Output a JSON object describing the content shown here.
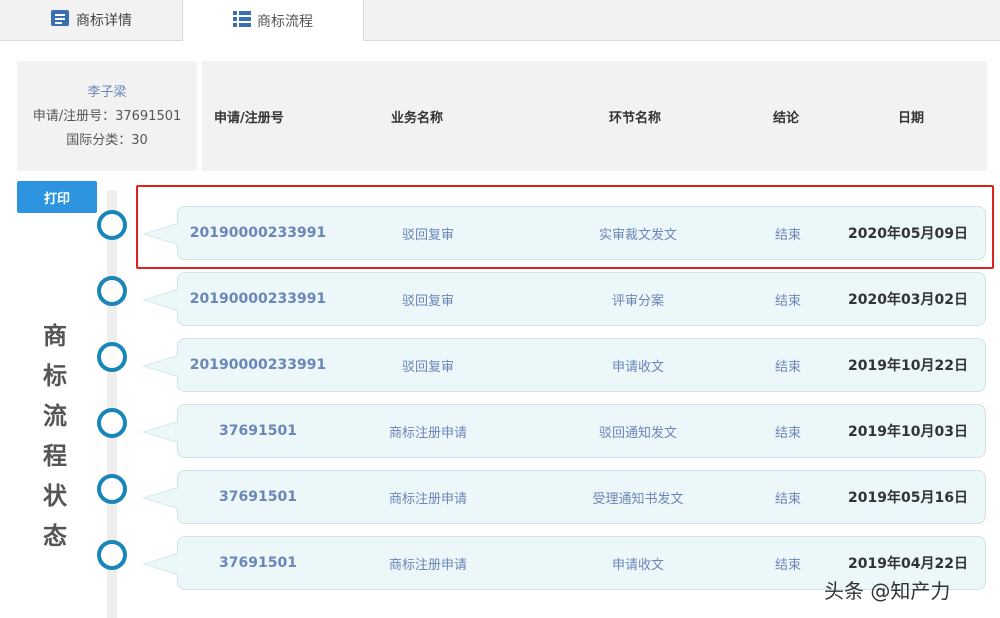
{
  "tabs": [
    {
      "label": "商标详情",
      "icon": "document-icon"
    },
    {
      "label": "商标流程",
      "icon": "list-icon"
    }
  ],
  "info": {
    "name": "李子梁",
    "reg_no": "申请/注册号：37691501",
    "intl_class": "国际分类：30"
  },
  "header": {
    "col_no": "申请/注册号",
    "col_business": "业务名称",
    "col_step": "环节名称",
    "col_result": "结论",
    "col_date": "日期"
  },
  "print_label": "打印",
  "side_text": [
    "商",
    "标",
    "流",
    "程",
    "状",
    "态"
  ],
  "rows": [
    {
      "no": "20190000233991",
      "business": "驳回复审",
      "step": "实审裁文发文",
      "result": "结束",
      "date": "2020年05月09日"
    },
    {
      "no": "20190000233991",
      "business": "驳回复审",
      "step": "评审分案",
      "result": "结束",
      "date": "2020年03月02日"
    },
    {
      "no": "20190000233991",
      "business": "驳回复审",
      "step": "申请收文",
      "result": "结束",
      "date": "2019年10月22日"
    },
    {
      "no": "37691501",
      "business": "商标注册申请",
      "step": "驳回通知发文",
      "result": "结束",
      "date": "2019年10月03日"
    },
    {
      "no": "37691501",
      "business": "商标注册申请",
      "step": "受理通知书发文",
      "result": "结束",
      "date": "2019年05月16日"
    },
    {
      "no": "37691501",
      "business": "商标注册申请",
      "step": "申请收文",
      "result": "结束",
      "date": "2019年04月22日"
    }
  ],
  "watermark": "头条 @知产力",
  "colors": {
    "accent": "#2d95e0",
    "node": "#1a85b8",
    "highlight": "#e02020",
    "row_bg": "#ecf7f9"
  }
}
